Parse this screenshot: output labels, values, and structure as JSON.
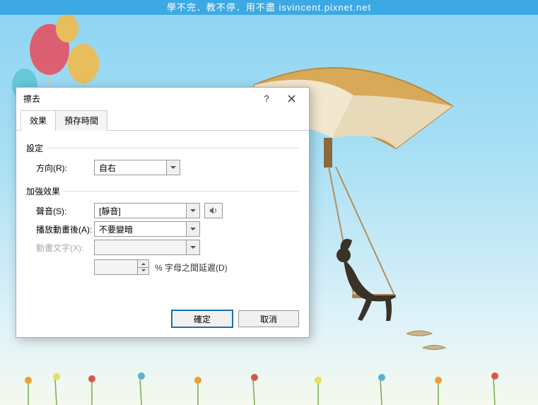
{
  "header": {
    "watermark": "學不完．教不停．用不盡 isvincent.pixnet.net"
  },
  "dialog": {
    "title": "擦去",
    "tabs": {
      "effect": "效果",
      "timing": "預存時間"
    },
    "section_settings": "設定",
    "section_enhance": "加強效果",
    "direction": {
      "label": "方向(R):",
      "value": "自右"
    },
    "sound": {
      "label": "聲音(S):",
      "value": "[靜音]"
    },
    "after": {
      "label": "播放動畫後(A):",
      "value": "不要變暗"
    },
    "animate_text": {
      "label": "動畫文字(X):",
      "value": ""
    },
    "delay": {
      "value": "",
      "suffix": "% 字母之間延遲(D)"
    },
    "buttons": {
      "ok": "確定",
      "cancel": "取消"
    },
    "help": "?"
  }
}
